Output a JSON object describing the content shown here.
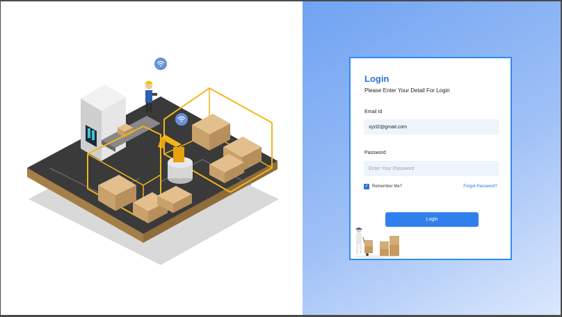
{
  "login": {
    "title": "Login",
    "subtitle": "Please Enter Your Detail For Login",
    "email": {
      "label": "Email Id",
      "value": "xyzl2@gmail.com",
      "placeholder": ""
    },
    "password": {
      "label": "Password",
      "value": "",
      "placeholder": "Enter Your Password"
    },
    "remember": {
      "label": "Remember Me?",
      "checked": true
    },
    "forgot_label": "Forgot Password?",
    "button_label": "Login"
  },
  "colors": {
    "accent": "#2f80ed",
    "title": "#2f6fd6",
    "card_border": "#2e8bf0",
    "input_bg": "#eef4fc"
  },
  "icons": {
    "wifi": "wifi-icon",
    "check": "check-icon"
  }
}
